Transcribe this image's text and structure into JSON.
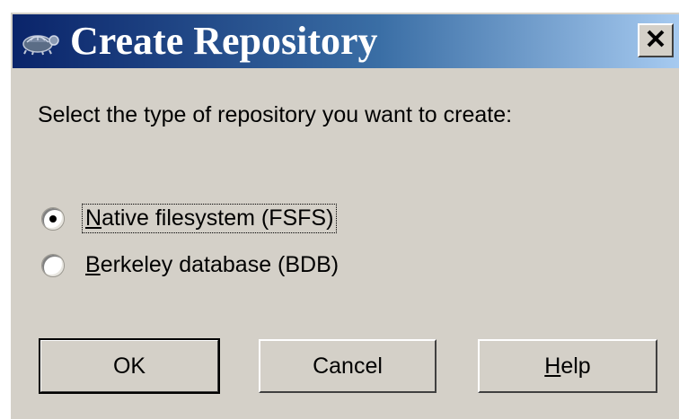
{
  "window": {
    "title": "Create Repository",
    "close_symbol": "✕",
    "icon": "tortoise-icon"
  },
  "prompt": "Select the type of repository you want to create:",
  "options": [
    {
      "label_first": "N",
      "label_rest": "ative filesystem (FSFS)",
      "selected": true
    },
    {
      "label_first": "B",
      "label_rest": "erkeley database (BDB)",
      "selected": false
    }
  ],
  "buttons": {
    "ok": "OK",
    "cancel": "Cancel",
    "help_first": "H",
    "help_rest": "elp"
  }
}
